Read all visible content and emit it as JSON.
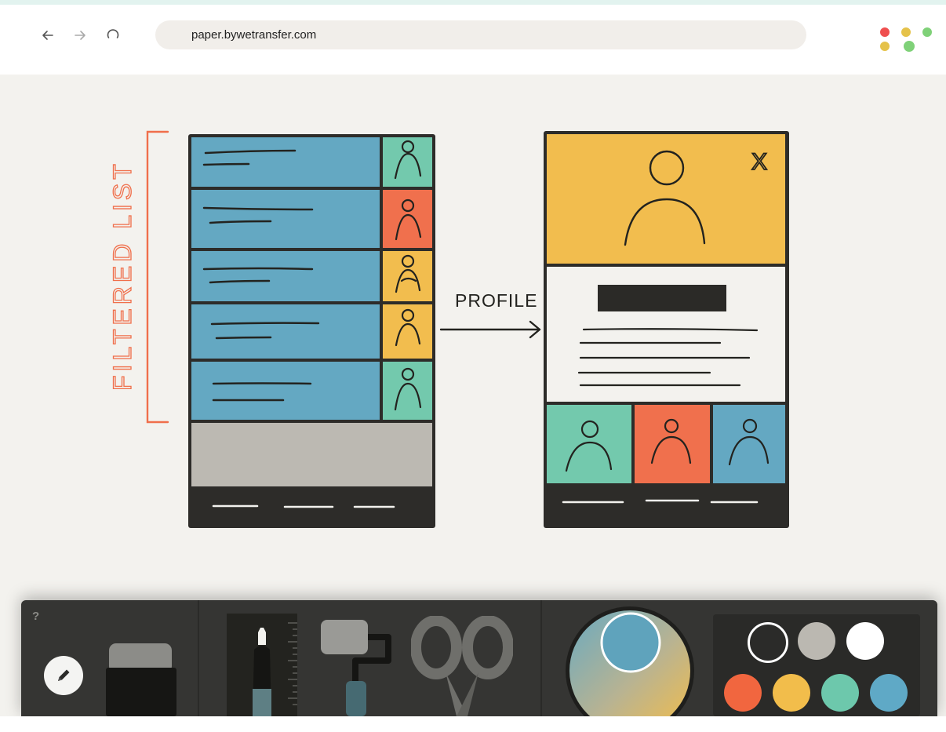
{
  "browser": {
    "url": "paper.bywetransfer.com",
    "nav": {
      "back_icon": "arrow-left-icon",
      "forward_icon": "arrow-right-icon",
      "reload_icon": "reload-icon"
    },
    "app_icon": "dots-logo-icon"
  },
  "sketch": {
    "bracket_label": "FILTERED LIST",
    "arrow_label": "PROFILE",
    "close_glyph": "X"
  },
  "toolbar": {
    "help_label": "?",
    "tools": [
      "pencil-toggle",
      "eraser",
      "marker",
      "ruler",
      "roller",
      "scissors",
      "color-wheel"
    ],
    "selected_color": "#5fa3bc",
    "palette": [
      {
        "name": "black",
        "color": "#2b2b29",
        "selected": true
      },
      {
        "name": "grey",
        "color": "#bbb8b1",
        "selected": false
      },
      {
        "name": "white",
        "color": "#ffffff",
        "selected": false
      },
      {
        "name": "red",
        "color": "#f1663f",
        "selected": false
      },
      {
        "name": "yellow",
        "color": "#f2bd4b",
        "selected": false
      },
      {
        "name": "green",
        "color": "#6dc8ac",
        "selected": false
      },
      {
        "name": "blue",
        "color": "#5fa9c6",
        "selected": false
      }
    ]
  }
}
